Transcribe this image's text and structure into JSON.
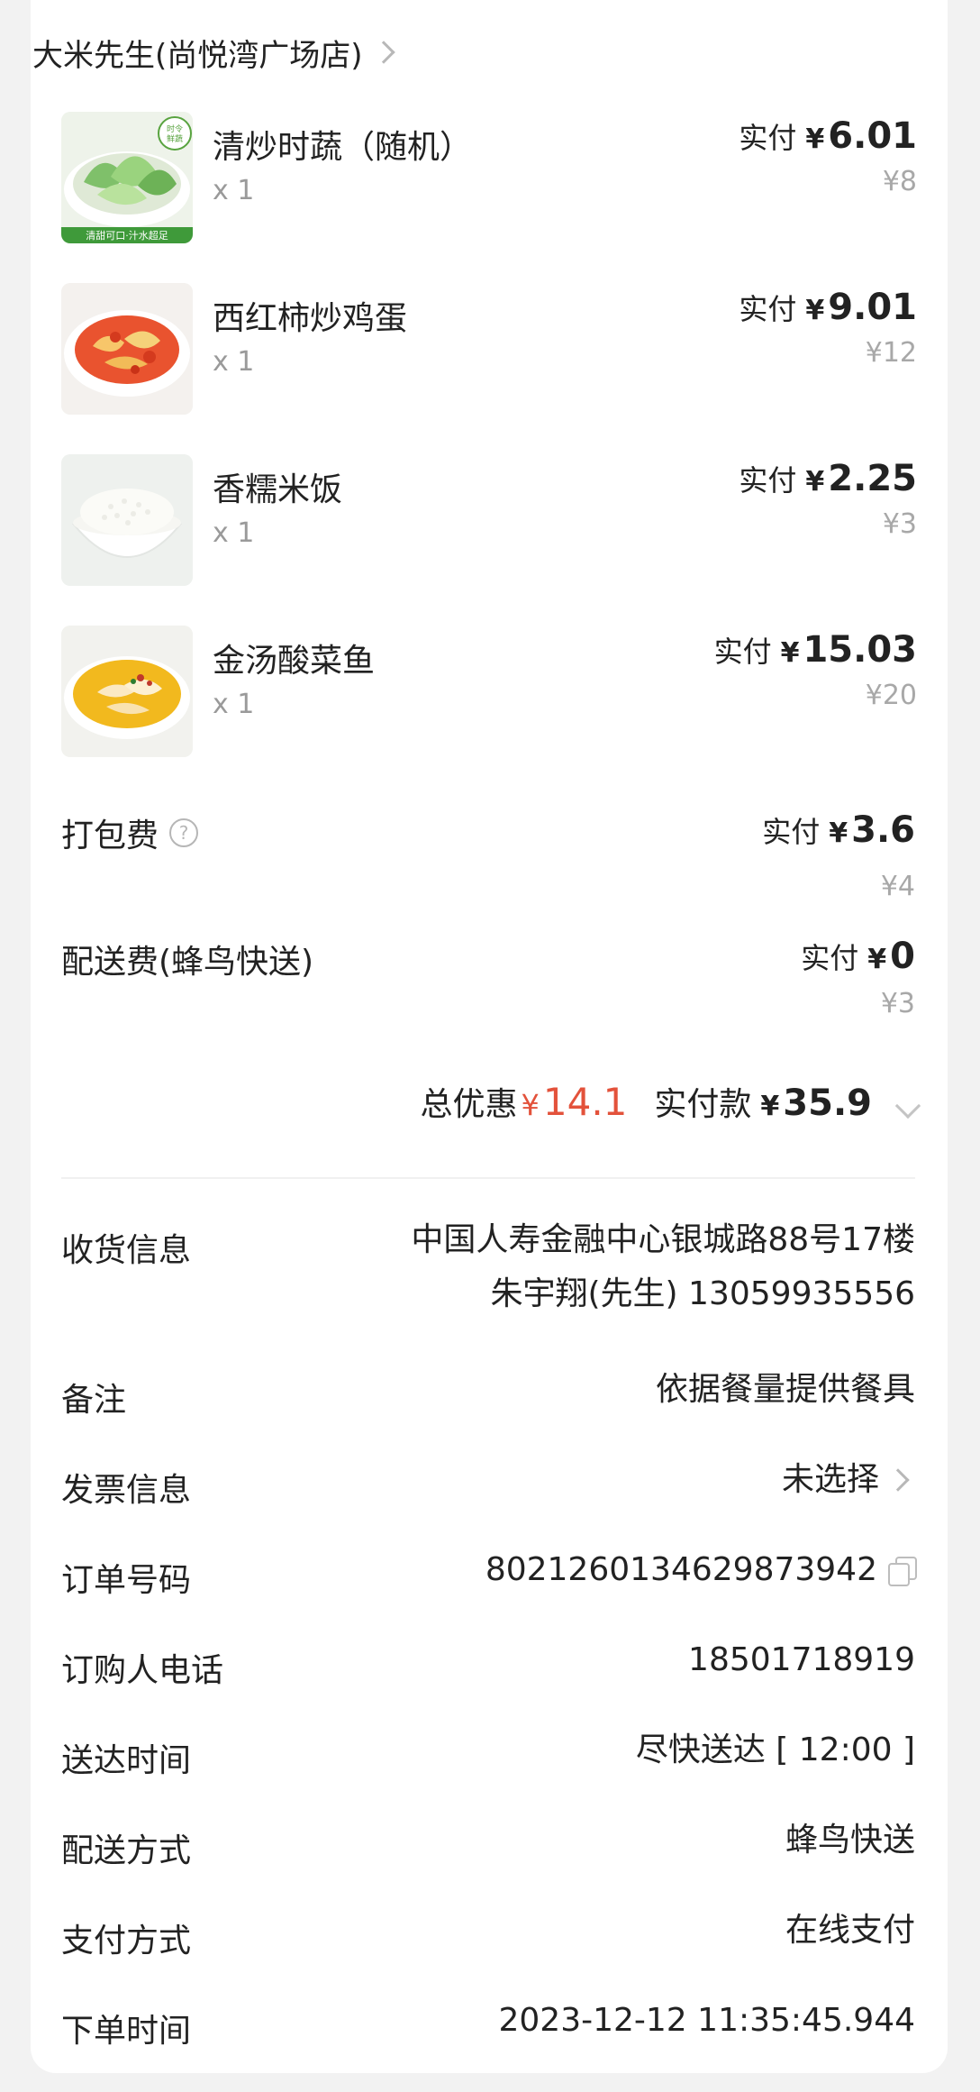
{
  "shop": {
    "name": "大米先生(尚悦湾广场店)"
  },
  "items": [
    {
      "name": "清炒时蔬（随机）",
      "qty": "x 1",
      "paid_label": "实付",
      "currency": "¥",
      "paid": "6.01",
      "original": "¥8",
      "image": "stir-fried-greens",
      "badge_top": "时令 鲜蔬",
      "badge_bottom": "清甜可口·汁水超足"
    },
    {
      "name": "西红柿炒鸡蛋",
      "qty": "x 1",
      "paid_label": "实付",
      "currency": "¥",
      "paid": "9.01",
      "original": "¥12",
      "image": "tomato-egg"
    },
    {
      "name": "香糯米饭",
      "qty": "x 1",
      "paid_label": "实付",
      "currency": "¥",
      "paid": "2.25",
      "original": "¥3",
      "image": "rice-bowl"
    },
    {
      "name": "金汤酸菜鱼",
      "qty": "x 1",
      "paid_label": "实付",
      "currency": "¥",
      "paid": "15.03",
      "original": "¥20",
      "image": "fish-soup"
    }
  ],
  "fees": [
    {
      "label": "打包费",
      "has_help_icon": true,
      "paid_label": "实付",
      "currency": "¥",
      "paid": "3.6",
      "original": "¥4"
    },
    {
      "label": "配送费(蜂鸟快送)",
      "has_help_icon": false,
      "paid_label": "实付",
      "currency": "¥",
      "paid": "0",
      "original": "¥3"
    }
  ],
  "totals": {
    "discount_label": "总优惠",
    "discount_currency": "¥",
    "discount": "14.1",
    "paid_label": "实付款",
    "paid_currency": "¥",
    "paid": "35.9"
  },
  "info": {
    "address": {
      "label": "收货信息",
      "line1": "中国人寿金融中心银城路88号17楼",
      "line2": "朱宇翔(先生) 13059935556"
    },
    "note": {
      "label": "备注",
      "value": "依据餐量提供餐具"
    },
    "invoice": {
      "label": "发票信息",
      "value": "未选择"
    },
    "order_no": {
      "label": "订单号码",
      "value": "8021260134629873942"
    },
    "phone": {
      "label": "订购人电话",
      "value": "18501718919"
    },
    "delivery_time": {
      "label": "送达时间",
      "value": "尽快送达 [ 12:00 ]"
    },
    "delivery_method": {
      "label": "配送方式",
      "value": "蜂鸟快送"
    },
    "payment_method": {
      "label": "支付方式",
      "value": "在线支付"
    },
    "order_time": {
      "label": "下单时间",
      "value": "2023-12-12 11:35:45.944"
    }
  },
  "colors": {
    "discount": "#e3523b",
    "background": "#f2f2f2",
    "card": "#ffffff",
    "muted": "#a8a8a8"
  }
}
